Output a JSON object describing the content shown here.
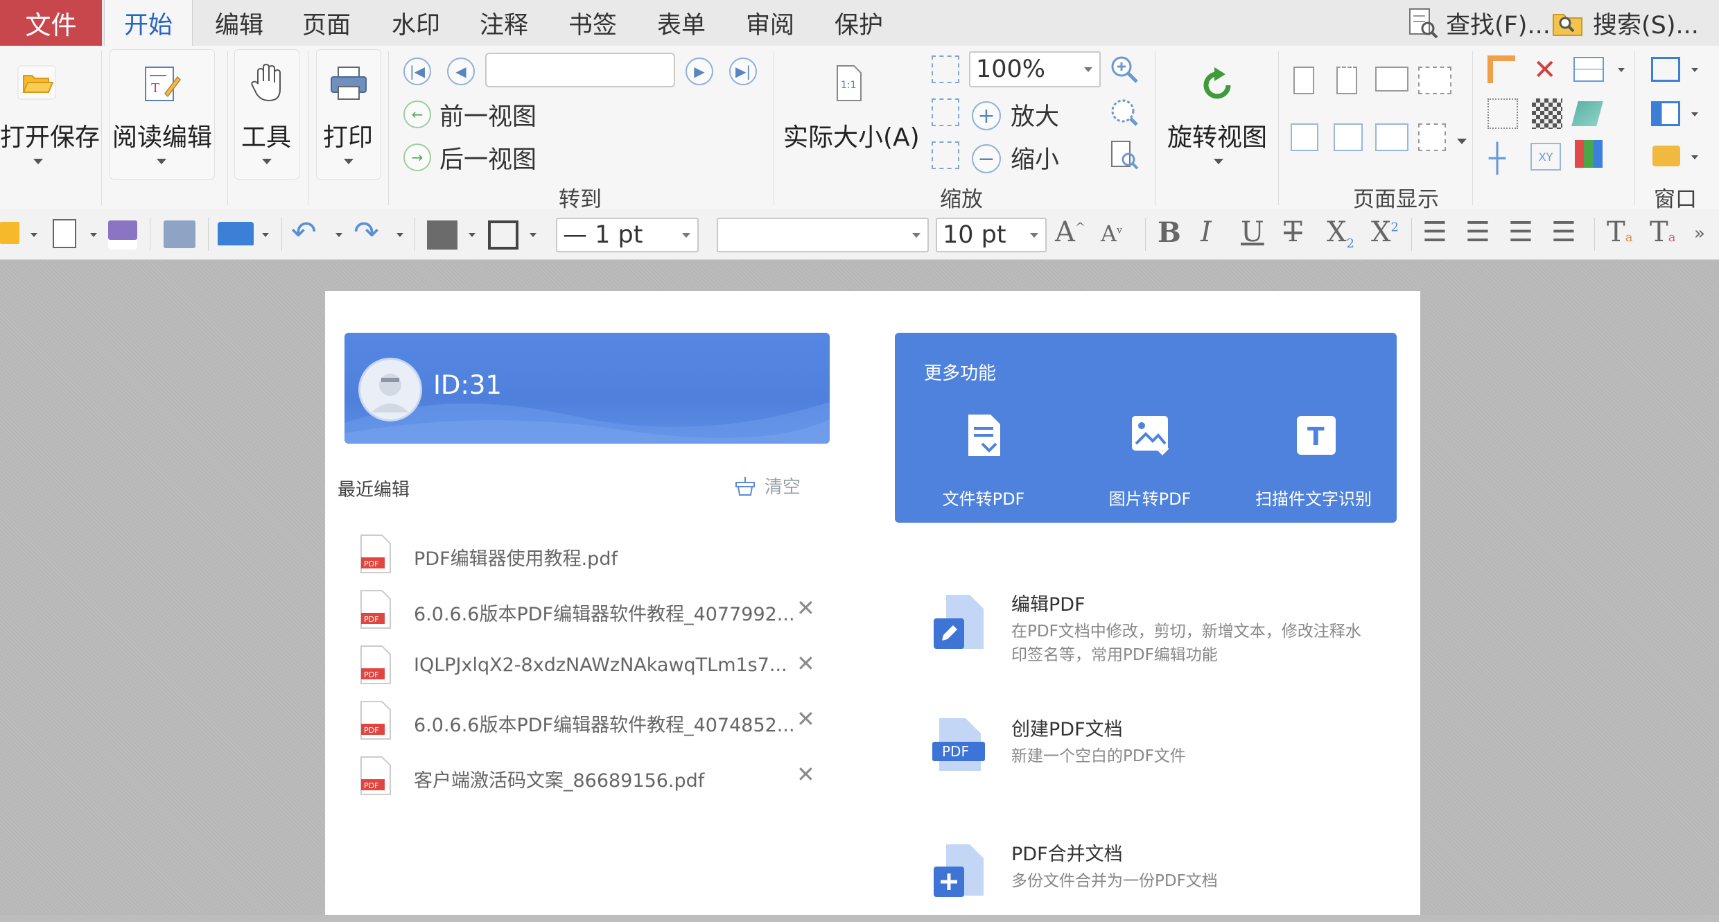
{
  "menubar": {
    "file": "文件",
    "tabs": [
      "开始",
      "编辑",
      "页面",
      "水印",
      "注释",
      "书签",
      "表单",
      "审阅",
      "保护"
    ],
    "find": "查找(F)...",
    "search": "搜索(S)..."
  },
  "ribbon": {
    "open_save": "打开保存",
    "read_edit": "阅读编辑",
    "tools": "工具",
    "print": "打印",
    "page_input": "",
    "prev_view": "前一视图",
    "next_view": "后一视图",
    "goto_label": "转到",
    "actual_size": "实际大小(A)",
    "zoom_value": "100%",
    "zoom_in": "放大",
    "zoom_out": "缩小",
    "zoom_label": "缩放",
    "rotate_view": "旋转视图",
    "page_display_label": "页面显示",
    "window_label": "窗口"
  },
  "toolbar": {
    "line_width": "— 1 pt",
    "font_name": "",
    "font_size": "10 pt"
  },
  "home": {
    "user_id": "ID:31",
    "recent_title": "最近编辑",
    "clear_label": "清空",
    "recent_files": [
      {
        "name": "PDF编辑器使用教程.pdf",
        "removable": false
      },
      {
        "name": "6.0.6.6版本PDF编辑器软件教程_4077992...",
        "removable": true
      },
      {
        "name": "IQLPJxlqX2-8xdzNAWzNAkawqTLm1s7...",
        "removable": true
      },
      {
        "name": "6.0.6.6版本PDF编辑器软件教程_4074852...",
        "removable": true
      },
      {
        "name": "客户端激活码文案_86689156.pdf",
        "removable": true
      }
    ],
    "more_title": "更多功能",
    "more_features": [
      "文件转PDF",
      "图片转PDF",
      "扫描件文字识别"
    ],
    "features": [
      {
        "title": "编辑PDF",
        "desc": "在PDF文档中修改，剪切，新增文本，修改注释水印签名等，常用PDF编辑功能"
      },
      {
        "title": "创建PDF文档",
        "desc": "新建一个空白的PDF文件"
      },
      {
        "title": "PDF合并文档",
        "desc": "多份文件合并为一份PDF文档"
      }
    ],
    "pdf_badge": "PDF"
  },
  "colors": {
    "file_tab": "#c8474c",
    "accent": "#4e82dc",
    "active_tab_text": "#2564c2"
  }
}
